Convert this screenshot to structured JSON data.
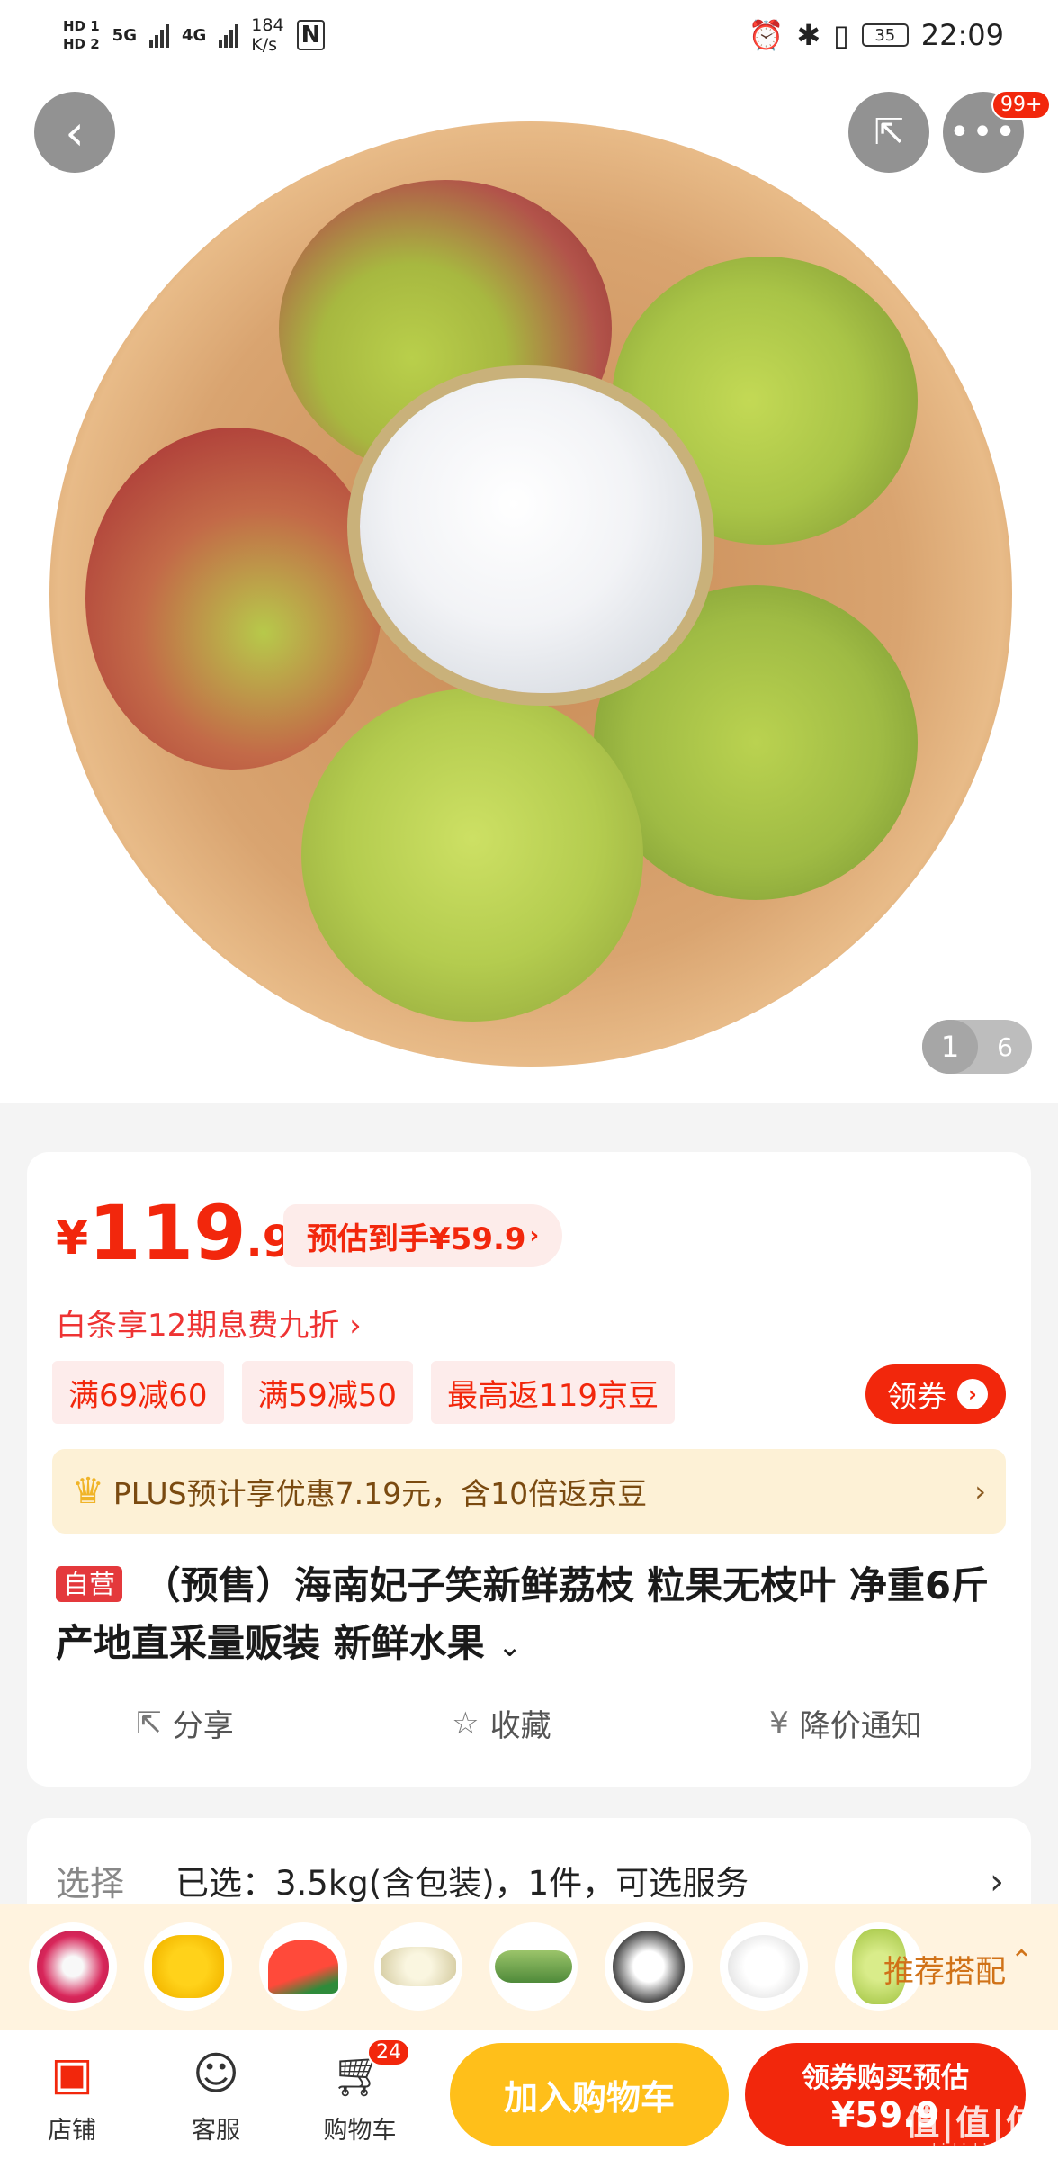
{
  "status_bar": {
    "hd1": "HD 1",
    "hd2": "HD 2",
    "sig1": "5G",
    "sig2": "4G",
    "speed_num": "184",
    "speed_unit": "K/s",
    "nfc": "N",
    "battery": "35",
    "time": "22:09"
  },
  "header": {
    "more_badge": "99+"
  },
  "gallery": {
    "current": "1",
    "total": "6"
  },
  "price": {
    "currency": "¥",
    "integer": "119",
    "decimal": ".90",
    "estimate": "预估到手¥59.9",
    "baitiao": "白条享12期息费九折 ›"
  },
  "coupons": [
    "满69减60",
    "满59减50",
    "最高返119京豆"
  ],
  "get_coupon_label": "领券",
  "plus": {
    "text": "PLUS预计享优惠7.19元，含10倍返京豆"
  },
  "product": {
    "tag": "自营",
    "title": "（预售）海南妃子笑新鲜荔枝 粒果无枝叶 净重6斤 产地直采量贩装 新鲜水果"
  },
  "actions": {
    "share": "分享",
    "favorite": "收藏",
    "price_alert": "降价通知"
  },
  "spec": {
    "label": "选择",
    "value": "已选：3.5kg(含包装)，1件，可选服务"
  },
  "recommend": {
    "label": "推荐搭配"
  },
  "bottom_nav": {
    "store": "店铺",
    "service": "客服",
    "cart": "购物车",
    "cart_count": "24",
    "add_cart": "加入购物车",
    "buy_line1": "领券购买预估",
    "buy_line2": "¥59.9"
  },
  "watermark": {
    "logo": "值|值|值",
    "site": "zhizhizhi.com"
  },
  "colors": {
    "accent": "#f2270c",
    "cart_button": "#ffbf1a",
    "plus_bg": "#fdf1d6"
  }
}
